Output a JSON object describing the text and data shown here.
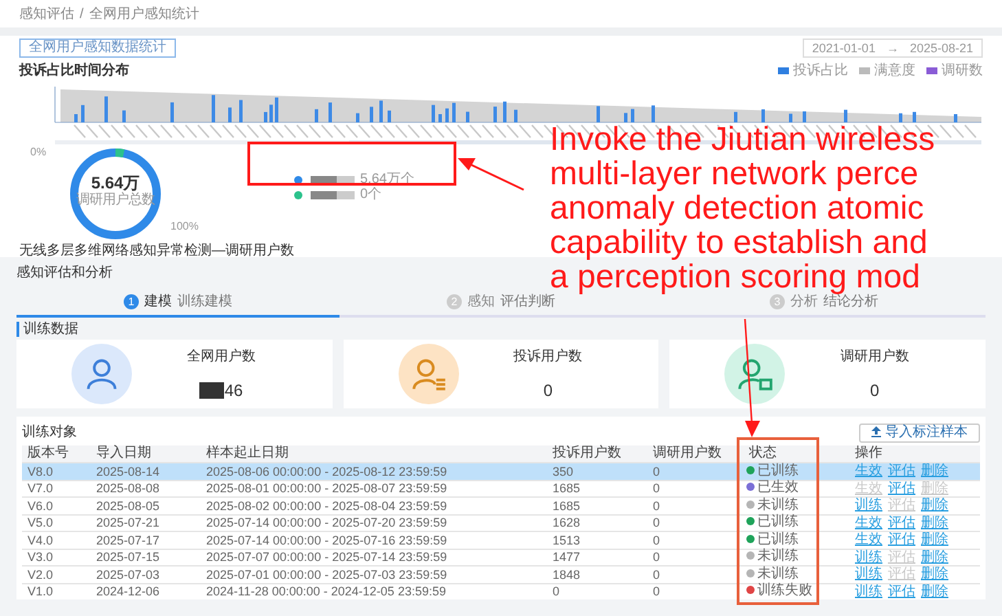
{
  "breadcrumb": [
    "感知评估",
    "全网用户感知统计"
  ],
  "breadcrumb_separator": "/",
  "overview": {
    "filter_button": "全网用户感知数据统计",
    "date_start": "2021-01-01",
    "date_arrow": "→",
    "date_end": "2025-08-21",
    "chart_title": "投诉占比时间分布",
    "legend": [
      {
        "label": "投诉占比",
        "color": "#2f7fe0"
      },
      {
        "label": "满意度",
        "color": "#bbbbbb"
      },
      {
        "label": "调研数",
        "color": "#8a5cd6"
      }
    ],
    "donut": {
      "value": "5.64万",
      "label": "调研用户总数",
      "top_label": "0%",
      "bottom_label": "100%",
      "legend": [
        {
          "label": "5.64万个",
          "color": "#2f8ae8"
        },
        {
          "label": "0个",
          "color": "#2cc28c"
        }
      ]
    },
    "caption": "无线多层多维网络感知异常检测—调研用户数"
  },
  "analysis": {
    "title": "感知评估和分析",
    "steps": [
      {
        "number": "1",
        "label": "建模",
        "sub": "训练建模",
        "selected": true
      },
      {
        "number": "2",
        "label": "感知",
        "sub": "评估判断",
        "selected": false
      },
      {
        "number": "3",
        "label": "分析",
        "sub": "结论分析",
        "selected": false
      }
    ],
    "subtitle": "训练数据",
    "stats": [
      {
        "kind": "user",
        "label": "全网用户数",
        "value": "46",
        "redacted": true
      },
      {
        "kind": "complaint",
        "label": "投诉用户数",
        "value": "0",
        "redacted": false
      },
      {
        "kind": "survey",
        "label": "调研用户数",
        "value": "0",
        "redacted": false
      }
    ],
    "table": {
      "title": "训练对象",
      "import_button": "导入标注样本",
      "columns": [
        "版本号",
        "导入日期",
        "样本起止日期",
        "投诉用户数",
        "调研用户数",
        "状态",
        "操作"
      ],
      "rows": [
        {
          "selected": true,
          "cells": [
            "V8.0",
            "2025-08-14",
            "2025-08-06 00:00:00 - 2025-08-12 23:59:59",
            "350",
            "0"
          ],
          "status": "已训练",
          "color": "#1fa35a",
          "actions": [
            {
              "label": "生效",
              "disabled": false
            },
            {
              "label": "评估",
              "disabled": false
            },
            {
              "label": "删除",
              "disabled": false
            }
          ]
        },
        {
          "selected": false,
          "cells": [
            "V7.0",
            "2025-08-08",
            "2025-08-01 00:00:00 - 2025-08-07 23:59:59",
            "1685",
            "0"
          ],
          "status": "已生效",
          "color": "#7b6fd6",
          "actions": [
            {
              "label": "生效",
              "disabled": true
            },
            {
              "label": "评估",
              "disabled": false
            },
            {
              "label": "删除",
              "disabled": true
            }
          ]
        },
        {
          "selected": false,
          "cells": [
            "V6.0",
            "2025-08-05",
            "2025-08-02 00:00:00 - 2025-08-04 23:59:59",
            "1685",
            "0"
          ],
          "status": "未训练",
          "color": "#b5b5b5",
          "actions": [
            {
              "label": "训练",
              "disabled": false
            },
            {
              "label": "评估",
              "disabled": true
            },
            {
              "label": "删除",
              "disabled": false
            }
          ]
        },
        {
          "selected": false,
          "cells": [
            "V5.0",
            "2025-07-21",
            "2025-07-14 00:00:00 - 2025-07-20 23:59:59",
            "1628",
            "0"
          ],
          "status": "已训练",
          "color": "#1fa35a",
          "actions": [
            {
              "label": "生效",
              "disabled": false
            },
            {
              "label": "评估",
              "disabled": false
            },
            {
              "label": "删除",
              "disabled": false
            }
          ]
        },
        {
          "selected": false,
          "cells": [
            "V4.0",
            "2025-07-17",
            "2025-07-14 00:00:00 - 2025-07-16 23:59:59",
            "1513",
            "0"
          ],
          "status": "已训练",
          "color": "#1fa35a",
          "actions": [
            {
              "label": "生效",
              "disabled": false
            },
            {
              "label": "评估",
              "disabled": false
            },
            {
              "label": "删除",
              "disabled": false
            }
          ]
        },
        {
          "selected": false,
          "cells": [
            "V3.0",
            "2025-07-15",
            "2025-07-07 00:00:00 - 2025-07-14 23:59:59",
            "1477",
            "0"
          ],
          "status": "未训练",
          "color": "#b5b5b5",
          "actions": [
            {
              "label": "训练",
              "disabled": false
            },
            {
              "label": "评估",
              "disabled": true
            },
            {
              "label": "删除",
              "disabled": false
            }
          ]
        },
        {
          "selected": false,
          "cells": [
            "V2.0",
            "2025-07-03",
            "2025-07-01 00:00:00 - 2025-07-03 23:59:59",
            "1848",
            "0"
          ],
          "status": "未训练",
          "color": "#b5b5b5",
          "actions": [
            {
              "label": "训练",
              "disabled": false
            },
            {
              "label": "评估",
              "disabled": true
            },
            {
              "label": "删除",
              "disabled": false
            }
          ]
        },
        {
          "selected": false,
          "cells": [
            "V1.0",
            "2024-12-06",
            "2024-11-28 00:00:00 - 2024-12-05 23:59:59",
            "0",
            "0"
          ],
          "status": "训练失败",
          "color": "#e04545",
          "actions": [
            {
              "label": "训练",
              "disabled": false
            },
            {
              "label": "评估",
              "disabled": false
            },
            {
              "label": "删除",
              "disabled": false
            }
          ]
        }
      ]
    }
  },
  "annotation": {
    "lines": [
      "Invoke the Jiutian wireless",
      "multi-layer network perce",
      "anomaly detection atomic",
      "capability to establish and",
      "a perception scoring mod"
    ]
  }
}
